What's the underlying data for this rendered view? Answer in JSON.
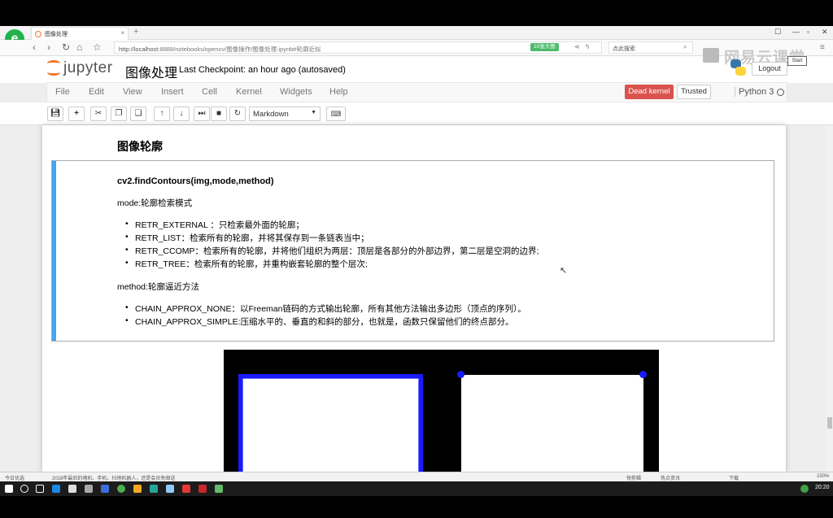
{
  "browser": {
    "tab_title": "图像处理",
    "new_tab": "+",
    "url_host": "http://localhost",
    "url_rest": ":8888/notebooks/opencv/图像操作/图像处理.ipynb#轮廓近似",
    "badge": "10张大图",
    "search_placeholder": "点此搜索",
    "icons": [
      "back-icon",
      "forward-icon",
      "reload-icon",
      "home-icon",
      "star-icon"
    ]
  },
  "jupyter": {
    "logo_text": "jupyter",
    "notebook_name": "图像处理",
    "checkpoint": "Last Checkpoint: an hour ago (autosaved)",
    "logout": "Logout",
    "watermark": "网易云课堂",
    "tooltip": "Start"
  },
  "menubar": {
    "items": [
      "File",
      "Edit",
      "View",
      "Insert",
      "Cell",
      "Kernel",
      "Widgets",
      "Help"
    ],
    "dead_kernel": "Dead kernel",
    "trusted": "Trusted",
    "kernel_name": "Python 3"
  },
  "toolbar": {
    "cell_type": "Markdown"
  },
  "notebook": {
    "heading": "图像轮廓",
    "function": "cv2.findContours(img,mode,method)",
    "mode_label": "mode:轮廓检索模式",
    "modes": [
      "RETR_EXTERNAL ：只检索最外面的轮廓；",
      "RETR_LIST：检索所有的轮廓，并将其保存到一条链表当中；",
      "RETR_CCOMP：检索所有的轮廓，并将他们组织为两层：顶层是各部分的外部边界，第二层是空洞的边界;",
      "RETR_TREE：检索所有的轮廓，并重构嵌套轮廓的整个层次;"
    ],
    "method_label": "method:轮廓逼近方法",
    "methods": [
      "CHAIN_APPROX_NONE：以Freeman链码的方式输出轮廓，所有其他方法输出多边形（顶点的序列）。",
      "CHAIN_APPROX_SIMPLE:压缩水平的、垂直的和斜的部分，也就是，函数只保留他们的终点部分。"
    ]
  },
  "statusbar": {
    "left": "今日优选",
    "news": "2018年最后的堵机、手机、扫地机器人，还是会员免邮送",
    "right_a": "快剪辑",
    "right_b": "热点资讯",
    "download": "下载",
    "zoom": "150%"
  },
  "taskbar": {
    "clock": "20:20"
  }
}
